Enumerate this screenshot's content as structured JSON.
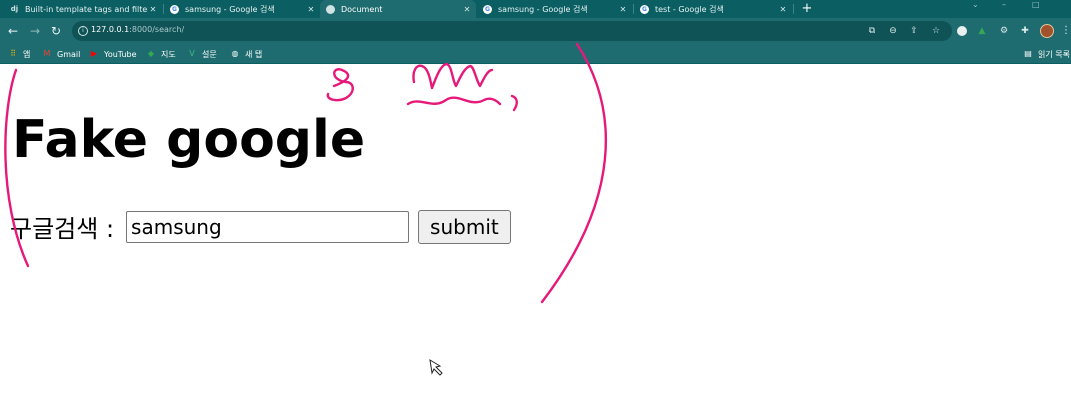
{
  "browser": {
    "tabs": [
      {
        "title": "Built-in template tags and filters",
        "favicon": "django-icon",
        "active": false
      },
      {
        "title": "samsung - Google 검색",
        "favicon": "google-icon",
        "active": false
      },
      {
        "title": "Document",
        "favicon": "globe-icon",
        "active": true
      },
      {
        "title": "samsung - Google 검색",
        "favicon": "google-icon",
        "active": false
      },
      {
        "title": "test - Google 검색",
        "favicon": "google-icon",
        "active": false
      }
    ],
    "new_tab_symbol": "+",
    "url_host": "127.0.0.1",
    "url_rest": ":8000/search/",
    "bookmarks": [
      {
        "label": "앱",
        "icon": "apps-grid-icon"
      },
      {
        "label": "Gmail",
        "icon": "gmail-icon"
      },
      {
        "label": "YouTube",
        "icon": "youtube-icon"
      },
      {
        "label": "지도",
        "icon": "maps-icon"
      },
      {
        "label": "설문",
        "icon": "vuejs-icon"
      },
      {
        "label": "새 탭",
        "icon": "globe-icon"
      }
    ],
    "reading_list_label": "읽기 목록",
    "theme_color": "#1e6c70",
    "tab_strip_color": "#0b5f63"
  },
  "page": {
    "heading": "Fake google",
    "search_label": "구글검색 :",
    "search_value": "samsung",
    "submit_label": "submit"
  },
  "annotation": {
    "color": "#e6197a",
    "description_icon": "pen-annotation-icon"
  }
}
